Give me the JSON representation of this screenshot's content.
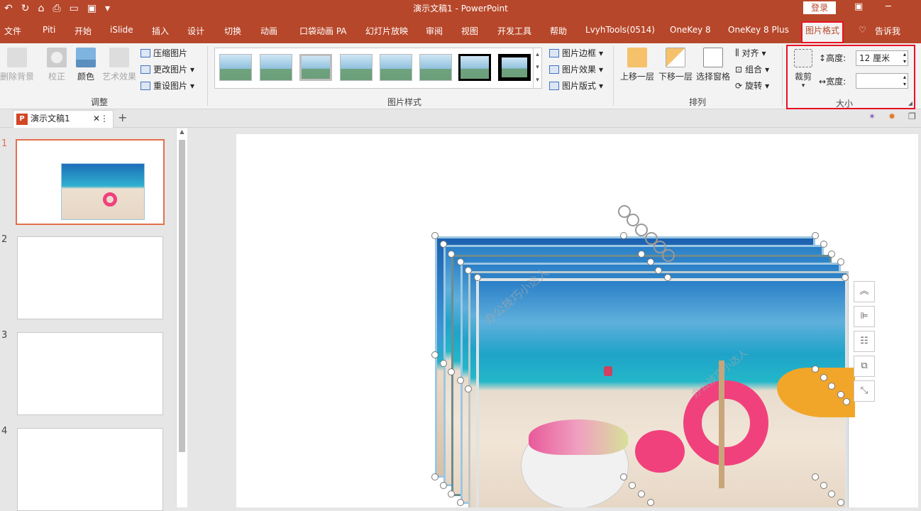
{
  "window": {
    "title": "演示文稿1 - PowerPoint",
    "login_label": "登录"
  },
  "menu_tabs": [
    "文件",
    "Piti",
    "开始",
    "iSlide",
    "插入",
    "设计",
    "切换",
    "动画",
    "口袋动画 PA",
    "幻灯片放映",
    "审阅",
    "视图",
    "开发工具",
    "帮助",
    "LvyhTools(0514)",
    "OneKey 8",
    "OneKey 8 Plus",
    "图片格式",
    "告诉我"
  ],
  "ribbon": {
    "adjust": {
      "remove_bg": "删除背景",
      "corrections": "校正",
      "color": "颜色",
      "artistic": "艺术效果",
      "compress": "压缩图片",
      "change": "更改图片",
      "reset": "重设图片",
      "label": "调整"
    },
    "styles": {
      "border": "图片边框",
      "effects": "图片效果",
      "layout": "图片版式",
      "label": "图片样式"
    },
    "arrange": {
      "forward": "上移一层",
      "backward": "下移一层",
      "pane": "选择窗格",
      "align": "对齐",
      "group": "组合",
      "rotate": "旋转",
      "label": "排列"
    },
    "size": {
      "crop": "裁剪",
      "height_label": "高度:",
      "height_value": "12 厘米",
      "width_label": "宽度:",
      "width_value": "",
      "label": "大小"
    }
  },
  "doc_tab": "演示文稿1",
  "slides": [
    "1",
    "2",
    "3",
    "4"
  ],
  "watermark": "办公技巧小达人"
}
